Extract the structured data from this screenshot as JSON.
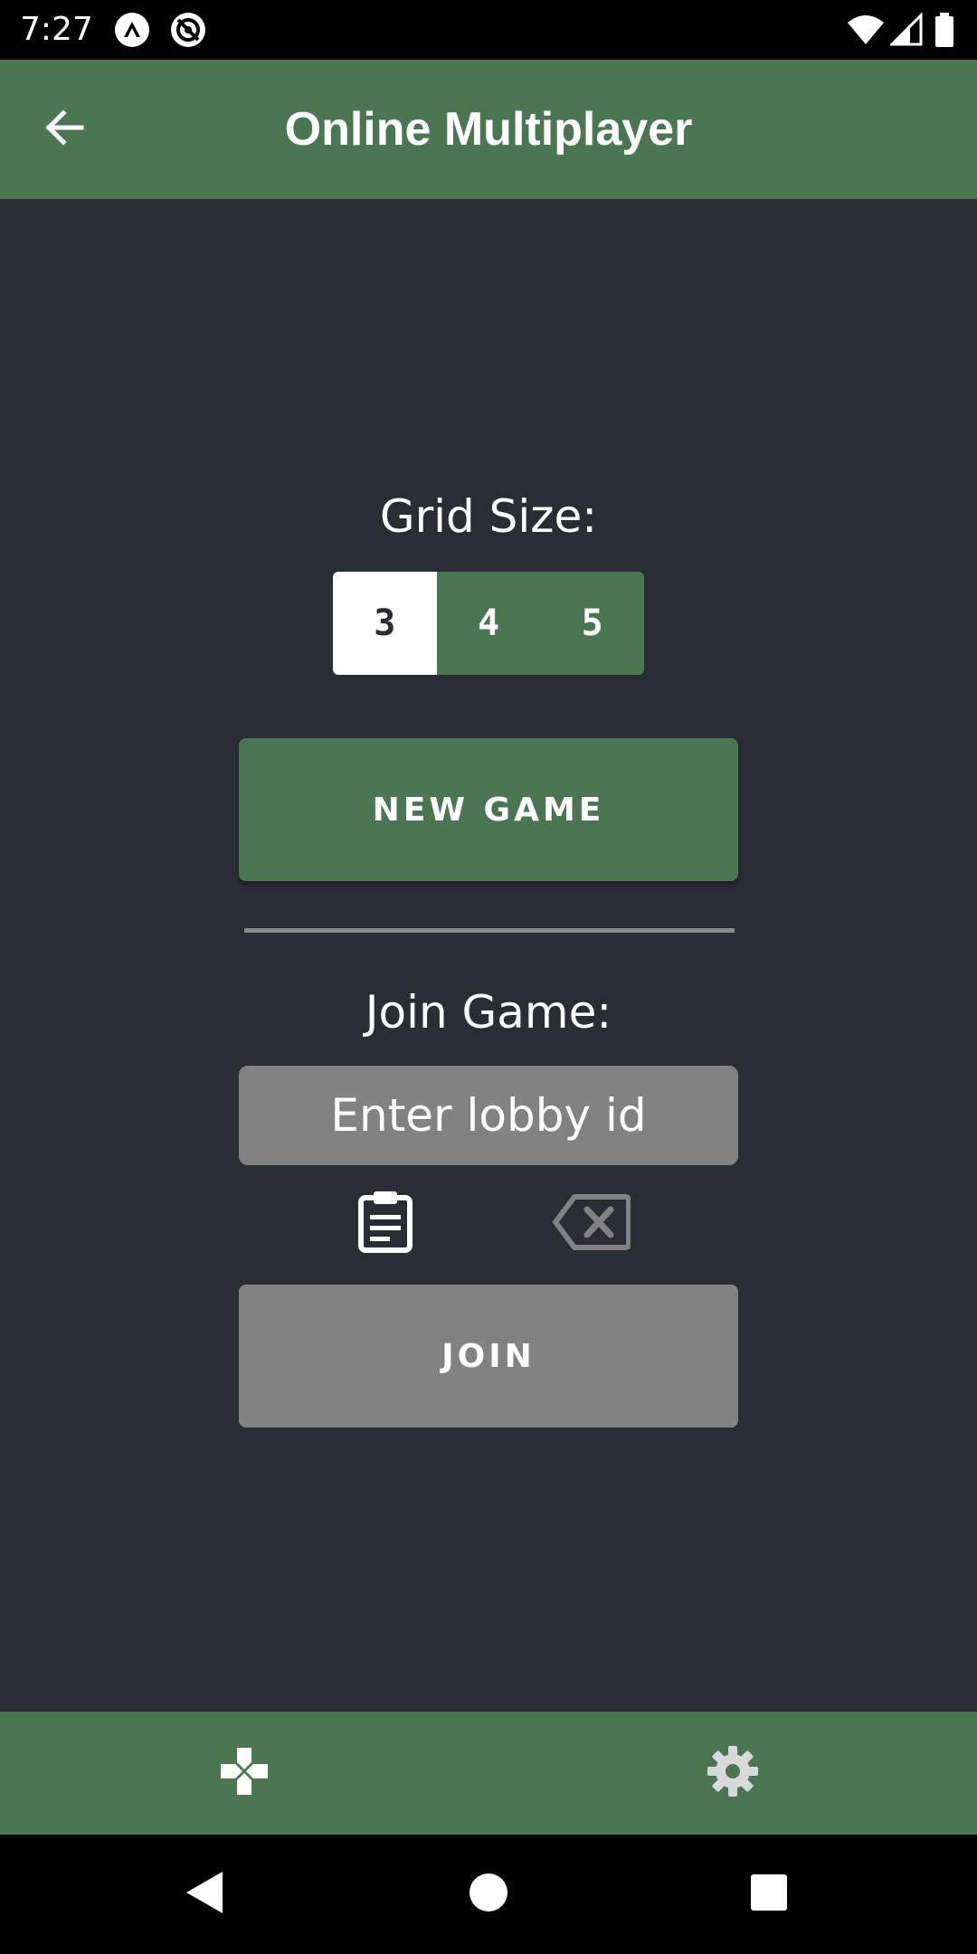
{
  "status_bar": {
    "time": "7:27",
    "icons": [
      "app-notification-icon",
      "sync-notification-icon",
      "wifi-icon",
      "cellular-signal-icon",
      "battery-icon"
    ]
  },
  "app_bar": {
    "title": "Online Multiplayer",
    "back_icon": "arrow-back-icon",
    "color": "#4a7751"
  },
  "grid_size": {
    "label": "Grid Size:",
    "options": [
      "3",
      "4",
      "5"
    ],
    "selected": "3"
  },
  "new_game": {
    "label": "NEW GAME"
  },
  "join": {
    "label": "Join Game:",
    "placeholder": "Enter lobby id",
    "value": "",
    "paste_icon": "clipboard-paste-icon",
    "clear_icon": "backspace-clear-icon",
    "button_label": "JOIN"
  },
  "bottom_nav": {
    "items": [
      {
        "icon": "gamepad-icon",
        "name": "play"
      },
      {
        "icon": "gear-icon",
        "name": "settings"
      }
    ]
  },
  "system_nav": {
    "items": [
      "back-triangle-icon",
      "home-circle-icon",
      "recents-square-icon"
    ]
  },
  "colors": {
    "background": "#2b2d35",
    "primary": "#4a7751",
    "disabled": "#828282"
  }
}
